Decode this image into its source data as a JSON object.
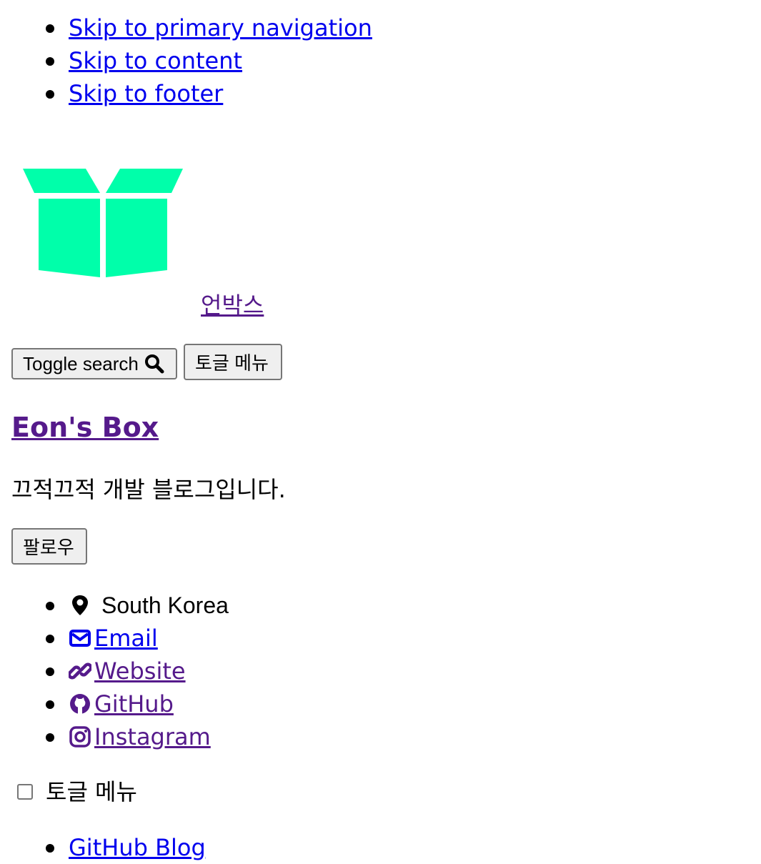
{
  "skip_links": [
    {
      "label": "Skip to primary navigation"
    },
    {
      "label": "Skip to content"
    },
    {
      "label": "Skip to footer"
    }
  ],
  "masthead": {
    "logo_alt": "언박스",
    "site_title": "언박스",
    "toggle_search_label": "Toggle search",
    "toggle_menu_label": "토글 메뉴",
    "logo_color": "#00ffaa"
  },
  "author": {
    "name": "Eon's Box",
    "bio": "끄적끄적 개발 블로그입니다.",
    "follow_label": "팔로우",
    "links": [
      {
        "label": "South Korea",
        "icon": "map-marker-icon",
        "is_link": false
      },
      {
        "label": "Email",
        "icon": "envelope-icon",
        "is_link": true
      },
      {
        "label": "Website",
        "icon": "link-icon",
        "is_link": true
      },
      {
        "label": "GitHub",
        "icon": "github-icon",
        "is_link": true
      },
      {
        "label": "Instagram",
        "icon": "instagram-icon",
        "is_link": true
      }
    ]
  },
  "sidebar_nav": {
    "toggle_label": "토글 메뉴",
    "items": [
      {
        "label": "GitHub Blog"
      }
    ]
  },
  "colors": {
    "link": "#0000ee",
    "visited": "#551a8b"
  }
}
